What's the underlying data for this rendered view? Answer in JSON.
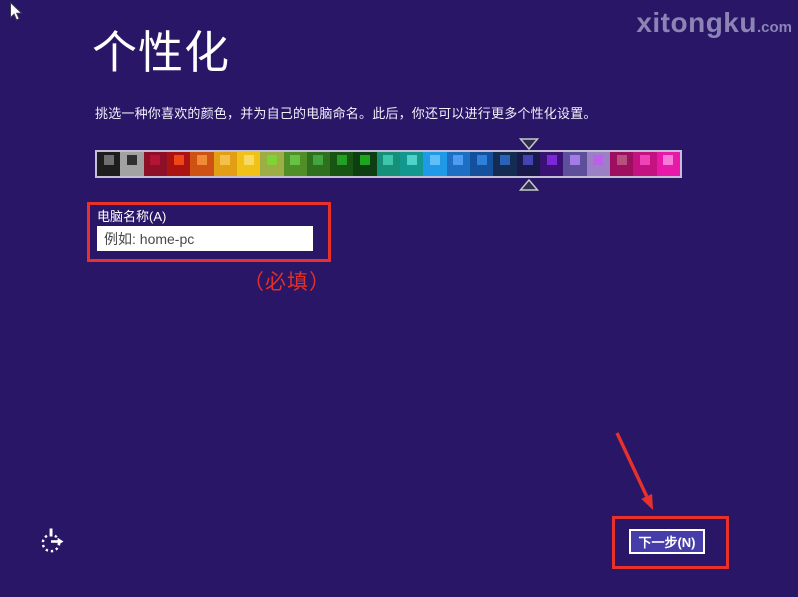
{
  "watermark": {
    "name": "xitongku",
    "tld": ".com",
    "color": "#8b84b4"
  },
  "header": {
    "title": "个性化",
    "subtitle": "挑选一种你喜欢的颜色，并为自己的电脑命名。此后，你还可以进行更多个性化设置。"
  },
  "palette": {
    "selected_index": 18,
    "swatches": [
      {
        "bg": "#1d1d1d",
        "inner": "#6f6f6f"
      },
      {
        "bg": "#a2a2a2",
        "inner": "#2f2f2f"
      },
      {
        "bg": "#8e1028",
        "inner": "#b51535"
      },
      {
        "bg": "#ab1212",
        "inner": "#ef4617"
      },
      {
        "bg": "#cf5215",
        "inner": "#f08a36"
      },
      {
        "bg": "#e29e14",
        "inner": "#f4c04a"
      },
      {
        "bg": "#f2c118",
        "inner": "#f7da62"
      },
      {
        "bg": "#9dae44",
        "inner": "#7fd435"
      },
      {
        "bg": "#508f28",
        "inner": "#66c244"
      },
      {
        "bg": "#2e701d",
        "inner": "#42a53f"
      },
      {
        "bg": "#185513",
        "inner": "#23a023"
      },
      {
        "bg": "#0d3f12",
        "inner": "#1ea51e"
      },
      {
        "bg": "#169079",
        "inner": "#3cc7ad"
      },
      {
        "bg": "#12988e",
        "inner": "#4fd2c8"
      },
      {
        "bg": "#1f9ae8",
        "inner": "#62bef8"
      },
      {
        "bg": "#1d6fc4",
        "inner": "#4d9cf0"
      },
      {
        "bg": "#14509e",
        "inner": "#2f80d8"
      },
      {
        "bg": "#142c52",
        "inner": "#2a62b8"
      },
      {
        "bg": "#1a1a4a",
        "inner": "#4343b4"
      },
      {
        "bg": "#3a1273",
        "inner": "#7c27d8"
      },
      {
        "bg": "#5e4f9a",
        "inner": "#a37ce8"
      },
      {
        "bg": "#9c80c6",
        "inner": "#bb60e8"
      },
      {
        "bg": "#9e0f60",
        "inner": "#b5517f"
      },
      {
        "bg": "#c41280",
        "inner": "#f043b7"
      },
      {
        "bg": "#e818a8",
        "inner": "#f77ad8"
      }
    ]
  },
  "form": {
    "computer_name_label": "电脑名称(A)",
    "computer_name_placeholder": "例如: home-pc",
    "computer_name_value": ""
  },
  "annotations": {
    "required_note": "（必填）",
    "highlight_color": "#e8312b"
  },
  "footer": {
    "next_button_label": "下一步(N)"
  },
  "colors": {
    "background": "#291667",
    "button_fill": "#473daa",
    "strip_border": "#c3bfd8"
  },
  "icons": {
    "mouse_cursor": "arrow-pointer",
    "ease_of_access": "ease-of-access-dial",
    "marker_top": "triangle-down",
    "marker_bottom": "triangle-up",
    "annotation_arrow": "red-arrow-down-right"
  }
}
